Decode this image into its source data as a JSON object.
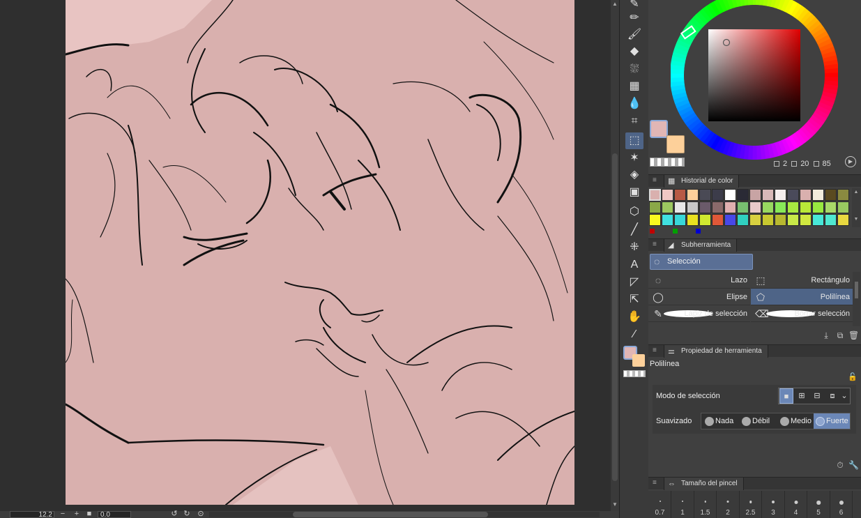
{
  "colors": {
    "canvas_bg": "#d9b0ae",
    "main_color": "#e1b6b5",
    "sub_color": "#fdd09a",
    "accent": "#4e6487"
  },
  "statusbar": {
    "zoom": "12.2",
    "angle": "0.0"
  },
  "toolbar": {
    "tools": [
      {
        "name": "pen-tool-icon",
        "glyph": "✎"
      },
      {
        "name": "pencil-tool-icon",
        "glyph": "✏"
      },
      {
        "name": "brush-tool-icon",
        "glyph": "🖌"
      },
      {
        "name": "eraser-tool-icon",
        "glyph": "◆"
      },
      {
        "name": "airbrush-tool-icon",
        "glyph": "⛆"
      },
      {
        "name": "decoration-tool-icon",
        "glyph": "▦"
      },
      {
        "name": "blend-tool-icon",
        "glyph": "💧"
      },
      {
        "name": "mesh-transform-icon",
        "glyph": "⌗"
      },
      {
        "name": "selection-tool-icon",
        "glyph": "⬚"
      },
      {
        "name": "auto-select-icon",
        "glyph": "✶"
      },
      {
        "name": "fill-tool-icon",
        "glyph": "◈"
      },
      {
        "name": "gradient-tool-icon",
        "glyph": "▣"
      },
      {
        "name": "3d-object-icon",
        "glyph": "⬡"
      },
      {
        "name": "figure-tool-icon",
        "glyph": "╱"
      },
      {
        "name": "ruler-tool-icon",
        "glyph": "⁜"
      },
      {
        "name": "text-tool-icon",
        "glyph": "A"
      },
      {
        "name": "frame-tool-icon",
        "glyph": "◸"
      },
      {
        "name": "operation-tool-icon",
        "glyph": "⇱"
      },
      {
        "name": "hand-tool-icon",
        "glyph": "✋"
      },
      {
        "name": "eyedropper-tool-icon",
        "glyph": "⁄"
      }
    ]
  },
  "color_wheel": {
    "hsv": [
      "2",
      "20",
      "85"
    ]
  },
  "history": {
    "title": "Historial de color",
    "rows": [
      [
        "#d9b0ae",
        "#f0c8c4",
        "#b85a44",
        "#fdd09a",
        "#4a4a55",
        "#3c3c4a",
        "#ffffff",
        "#2a2a35",
        "#c8a4a4",
        "#d8b8b8",
        "#f5eeee",
        "#4a4a5a",
        "#d9b0ae",
        "#f2ecdc",
        "#5a4a20",
        "#8a8a40"
      ],
      [
        "#8aa848",
        "#9cc860",
        "#e8e8e8",
        "#c8c8c8",
        "#6a5a6a",
        "#8a6a6a",
        "#e0b0b0",
        "#78c070",
        "#e8c8c8",
        "#98d860",
        "#88e858",
        "#a8e840",
        "#b8e838",
        "#98e840",
        "#a8d868",
        "#98c860"
      ],
      [
        "#f8f820",
        "#40e0e0",
        "#38d8d8",
        "#e8e020",
        "#d0e830",
        "#e05838",
        "#4848e8",
        "#30d0c0",
        "#d8d040",
        "#c8c830",
        "#b8b830",
        "#c8e848",
        "#d0e840",
        "#48e8d8",
        "#50e8d0",
        "#e8d840"
      ]
    ],
    "mini": [
      "#c00000",
      "#00a000",
      "#0000d0"
    ]
  },
  "subtool": {
    "title": "Subherramienta",
    "group": "Selección",
    "items": [
      {
        "label": "Lazo",
        "icon": "lasso-icon",
        "glyph": "◌",
        "col": 0,
        "row": 0,
        "active": false
      },
      {
        "label": "Rectángulo",
        "icon": "rectangle-select-icon",
        "glyph": "⬚",
        "col": 1,
        "row": 0,
        "active": false
      },
      {
        "label": "Elipse",
        "icon": "ellipse-select-icon",
        "glyph": "◯",
        "col": 0,
        "row": 1,
        "active": false
      },
      {
        "label": "Polilínea",
        "icon": "polyline-select-icon",
        "glyph": "⬠",
        "col": 1,
        "row": 1,
        "active": true
      },
      {
        "label": "Lápiz de selección",
        "icon": "selection-pen-icon",
        "glyph": "✎",
        "col": 0,
        "row": 2,
        "active": false
      },
      {
        "label": "Borrar selección",
        "icon": "erase-selection-icon",
        "glyph": "⌫",
        "col": 1,
        "row": 2,
        "active": false
      }
    ]
  },
  "tool_property": {
    "title": "Propiedad de herramienta",
    "tool_name": "Polilínea",
    "mode_label": "Modo de selección",
    "smooth_label": "Suavizado",
    "smooth_options": [
      {
        "label": "Nada",
        "active": false
      },
      {
        "label": "Débil",
        "active": false
      },
      {
        "label": "Medio",
        "active": false
      },
      {
        "label": "Fuerte",
        "active": true
      }
    ]
  },
  "brush_size": {
    "title": "Tamaño del pincel",
    "sizes": [
      "0.7",
      "1",
      "1.5",
      "2",
      "2.5",
      "3",
      "4",
      "5",
      "6"
    ]
  }
}
